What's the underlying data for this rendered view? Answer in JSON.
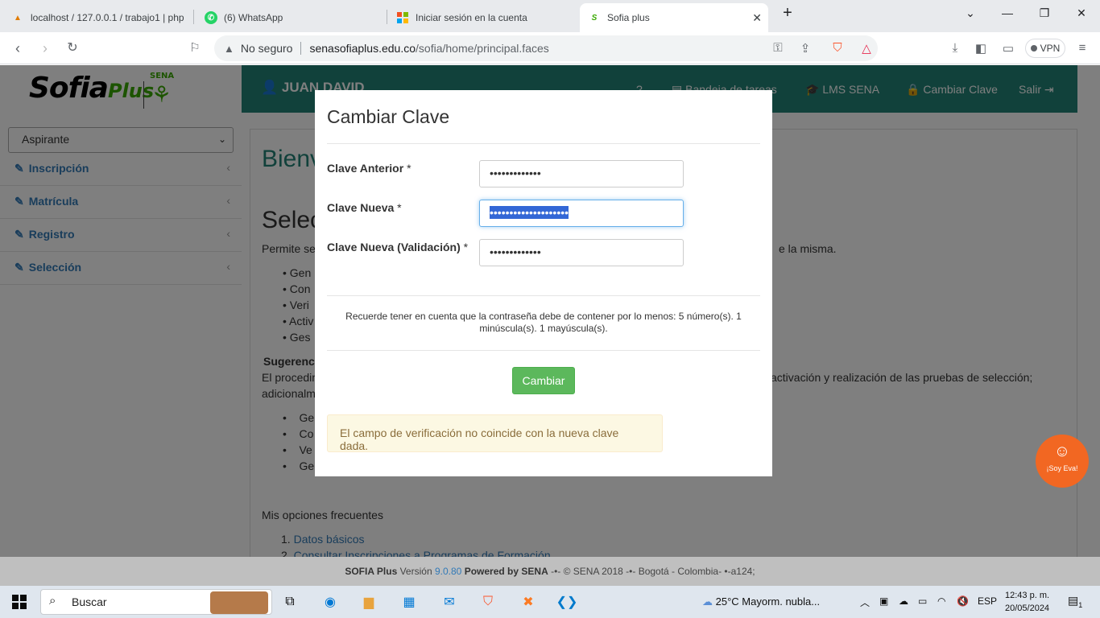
{
  "browser": {
    "tabs": [
      {
        "title": "localhost / 127.0.0.1 / trabajo1 | php",
        "icon": "phpmyadmin-icon"
      },
      {
        "title": "(6) WhatsApp",
        "icon": "whatsapp-icon"
      },
      {
        "title": "Iniciar sesión en la cuenta",
        "icon": "microsoft-icon"
      },
      {
        "title": "Sofia plus",
        "icon": "sofia-icon",
        "active": true
      }
    ],
    "security": "No seguro",
    "url_host": "senasofiaplus.edu.co",
    "url_path": "/sofia/home/principal.faces",
    "vpn": "VPN"
  },
  "site": {
    "logo_sofia": "Sofia",
    "logo_plus": "Plus",
    "logo_sena": "SENA",
    "user": "JUAN DAVID",
    "nav": [
      "Bandeja de tareas",
      "LMS SENA",
      "Cambiar Clave",
      "Salir"
    ],
    "role_select": "Aspirante",
    "sidebar": [
      "Inscripción",
      "Matrícula",
      "Registro",
      "Selección"
    ]
  },
  "background": {
    "heading1": "Bienv",
    "heading2": "Selec",
    "desc_start": "Permite se",
    "desc_end": "e la misma.",
    "bullets": [
      "Gen",
      "Con",
      "Veri",
      "Activ",
      "Ges"
    ],
    "sugerencia": "Sugerenci",
    "proc_start": "El procedim",
    "proc_end": "activación y realización de las pruebas de selección;",
    "proc_line2": "adicionalm",
    "bullets2": [
      "Ge",
      "Co",
      "Ve",
      "Ge"
    ],
    "opciones": "Mis opciones frecuentes",
    "opt1_num": "1.",
    "opt1": "Datos básicos",
    "opt2_num": "2.",
    "opt2": "Consultar Inscripciones a Programas de Formación"
  },
  "modal": {
    "title": "Cambiar Clave",
    "field1_label": "Clave Anterior",
    "field1_value": "•••••••••••••",
    "field2_label": "Clave Nueva",
    "field2_value": "••••••••••••••••••••",
    "field3_label": "Clave Nueva (Validación)",
    "field3_value": "•••••••••••••",
    "required": "*",
    "hint": "Recuerde tener en cuenta que la contraseña debe de contener por lo menos: 5 número(s). 1 minúscula(s). 1 mayúscula(s).",
    "button": "Cambiar",
    "alert": "El campo de verificación no coincide con la nueva clave dada."
  },
  "footer": {
    "product": "SOFIA Plus",
    "version_label": "Versión",
    "version": "9.0.80",
    "powered": "Powered by",
    "sena": "SENA",
    "rest": "-•- © SENA 2018 -•- Bogotá - Colombia- •-a124;"
  },
  "eva": "¡Soy Eva!",
  "taskbar": {
    "search": "Buscar",
    "weather": "25°C  Mayorm. nubla...",
    "lang": "ESP",
    "time": "12:43 p. m.",
    "date": "20/05/2024",
    "notif": "1"
  },
  "colors": {
    "sena_green": "#238276",
    "button_green": "#5cb85c",
    "alert_bg": "#fcf8e3",
    "eva_orange": "#f26722"
  }
}
